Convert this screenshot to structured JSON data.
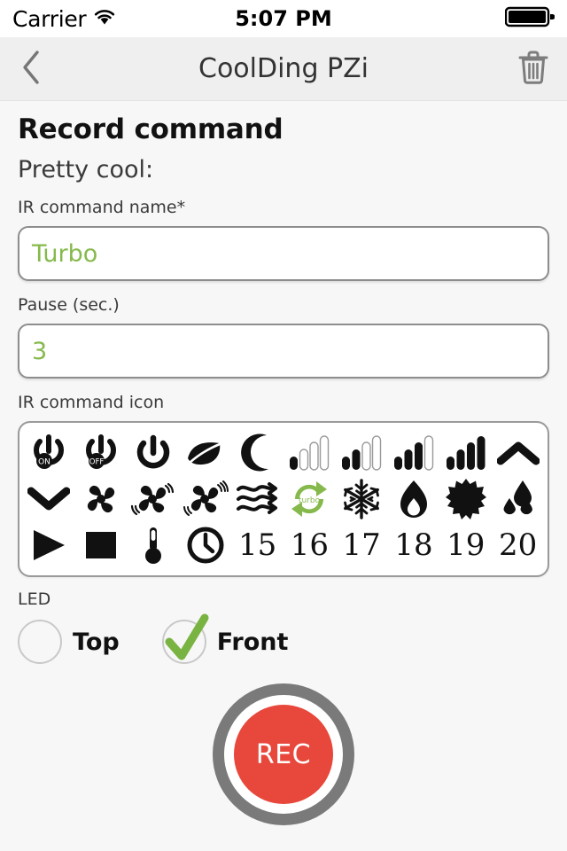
{
  "status_bar": {
    "carrier": "Carrier",
    "wifi_icon": "wifi-icon",
    "time": "5:07 PM",
    "battery_icon": "battery-full-icon"
  },
  "nav_bar": {
    "back_icon": "chevron-left-icon",
    "title": "CoolDing PZi",
    "delete_icon": "trash-icon"
  },
  "page": {
    "title": "Record command",
    "subtitle": "Pretty cool:"
  },
  "fields": {
    "name": {
      "label": "IR command name*",
      "value": "Turbo",
      "placeholder": "IR command name"
    },
    "pause": {
      "label": "Pause (sec.)",
      "value": "3",
      "placeholder": "Pause (sec.)"
    },
    "icon_picker": {
      "label": "IR command icon",
      "selected": "turbo",
      "rows": [
        [
          {
            "name": "power-on-icon",
            "kind": "icon",
            "selected": false
          },
          {
            "name": "power-off-icon",
            "kind": "icon",
            "selected": false
          },
          {
            "name": "power-icon",
            "kind": "icon",
            "selected": false
          },
          {
            "name": "leaf-icon",
            "kind": "icon",
            "selected": false
          },
          {
            "name": "moon-icon",
            "kind": "icon",
            "selected": false
          },
          {
            "name": "fan-speed-1-icon",
            "kind": "icon",
            "selected": false
          },
          {
            "name": "fan-speed-2-icon",
            "kind": "icon",
            "selected": false
          },
          {
            "name": "fan-speed-3-icon",
            "kind": "icon",
            "selected": false
          },
          {
            "name": "fan-speed-4-icon",
            "kind": "icon",
            "selected": false
          },
          {
            "name": "chevron-up-icon",
            "kind": "icon",
            "selected": false
          }
        ],
        [
          {
            "name": "chevron-down-icon",
            "kind": "icon",
            "selected": false
          },
          {
            "name": "fan-icon",
            "kind": "icon",
            "selected": false
          },
          {
            "name": "fan-spinning-icon",
            "kind": "icon",
            "selected": false
          },
          {
            "name": "fan-fast-icon",
            "kind": "icon",
            "selected": false
          },
          {
            "name": "airflow-icon",
            "kind": "icon",
            "selected": false
          },
          {
            "name": "turbo-icon",
            "kind": "icon",
            "selected": true,
            "label": "turbo"
          },
          {
            "name": "snowflake-icon",
            "kind": "icon",
            "selected": false
          },
          {
            "name": "flame-icon",
            "kind": "icon",
            "selected": false
          },
          {
            "name": "sun-icon",
            "kind": "icon",
            "selected": false
          },
          {
            "name": "humidity-drops-icon",
            "kind": "icon",
            "selected": false
          }
        ],
        [
          {
            "name": "play-icon",
            "kind": "icon",
            "selected": false
          },
          {
            "name": "stop-icon",
            "kind": "icon",
            "selected": false
          },
          {
            "name": "thermometer-icon",
            "kind": "icon",
            "selected": false
          },
          {
            "name": "clock-icon",
            "kind": "icon",
            "selected": false
          },
          {
            "name": "temp-15-icon",
            "kind": "number",
            "text": "15",
            "selected": false
          },
          {
            "name": "temp-16-icon",
            "kind": "number",
            "text": "16",
            "selected": false
          },
          {
            "name": "temp-17-icon",
            "kind": "number",
            "text": "17",
            "selected": false
          },
          {
            "name": "temp-18-icon",
            "kind": "number",
            "text": "18",
            "selected": false
          },
          {
            "name": "temp-19-icon",
            "kind": "number",
            "text": "19",
            "selected": false
          },
          {
            "name": "temp-20-icon",
            "kind": "number",
            "text": "20",
            "selected": false
          }
        ]
      ]
    },
    "led": {
      "label": "LED",
      "options": [
        {
          "label": "Top",
          "checked": false
        },
        {
          "label": "Front",
          "checked": true
        }
      ]
    }
  },
  "record_button": {
    "label": "REC"
  },
  "colors": {
    "accent_green": "#86b94b",
    "record_red": "#e8483c",
    "ring_gray": "#7a7a7a",
    "background": "#f7f7f7",
    "navbar": "#efefef"
  }
}
